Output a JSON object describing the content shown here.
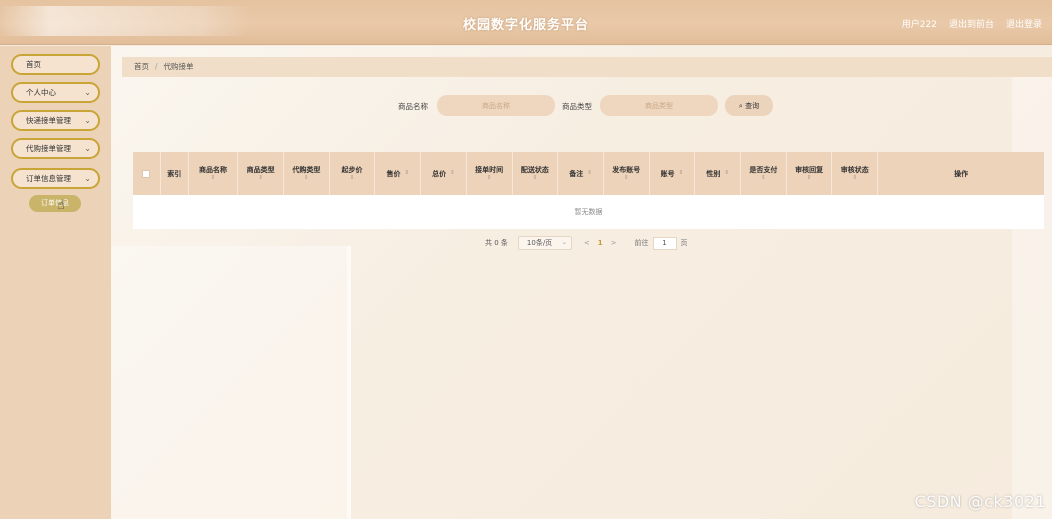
{
  "header": {
    "title": "校园数字化服务平台",
    "user": "用户222",
    "exit_to_front": "退出到前台",
    "logout": "退出登录"
  },
  "sidebar": {
    "items": [
      {
        "label": "首页",
        "has_arrow": false
      },
      {
        "label": "个人中心",
        "has_arrow": true
      },
      {
        "label": "快递接单管理",
        "has_arrow": true
      },
      {
        "label": "代购接单管理",
        "has_arrow": true
      },
      {
        "label": "订单信息管理",
        "has_arrow": true
      }
    ],
    "active_sub": "订单信息"
  },
  "breadcrumb": {
    "home": "首页",
    "separator": "/",
    "current": "代购接单"
  },
  "search": {
    "name_label": "商品名称",
    "name_placeholder": "商品名称",
    "type_label": "商品类型",
    "type_placeholder": "商品类型",
    "button": "查询",
    "button_icon": "search-icon"
  },
  "table": {
    "columns": [
      "索引",
      "商品名称",
      "商品类型",
      "代购类型",
      "起步价",
      "售价",
      "总价",
      "接单时间",
      "配送状态",
      "备注",
      "发布账号",
      "账号",
      "性别",
      "是否支付",
      "审核回复",
      "审核状态",
      "操作"
    ],
    "empty_text": "暂无数据"
  },
  "pagination": {
    "total": "共 0 条",
    "page_size": "10条/页",
    "prev": "<",
    "current_page": "1",
    "next": ">",
    "goto_label": "前往",
    "goto_value": "1",
    "page_unit": "页"
  },
  "watermark": "CSDN @ck3021",
  "colors": {
    "header": "#e5c3a0",
    "sidebar": "#ecd2b6",
    "accent_border": "#c9a437",
    "table_header": "#edd3b9"
  }
}
